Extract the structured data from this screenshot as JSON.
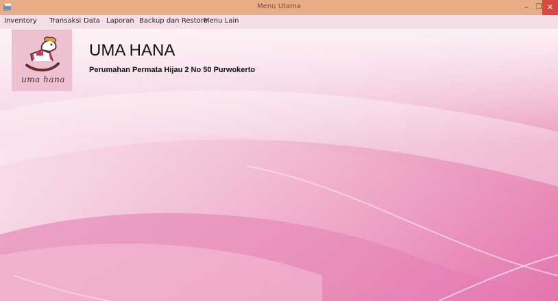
{
  "window": {
    "title": "Menu Utama",
    "minimize_glyph": "–",
    "maximize_glyph": "❐",
    "close_glyph": "✕"
  },
  "menu": {
    "items": [
      "Inventory",
      "Transaksi",
      "Data",
      "Laporan",
      "Backup dan Restore",
      "Menu Lain"
    ]
  },
  "header": {
    "logo_text": "uma hana",
    "company_name": "UMA HANA",
    "address": "Perumahan Permata Hijau 2 No 50 Purwokerto"
  },
  "icons": {
    "app": "app-icon",
    "logo": "rocking-horse-icon"
  },
  "colors": {
    "titlebar": "#e8ad87",
    "close_button": "#d9473f",
    "menubar": "#f4dfe9",
    "background_light": "#fbe9f1",
    "background_pink": "#e676ad",
    "logo_bg": "#eec1d2"
  }
}
